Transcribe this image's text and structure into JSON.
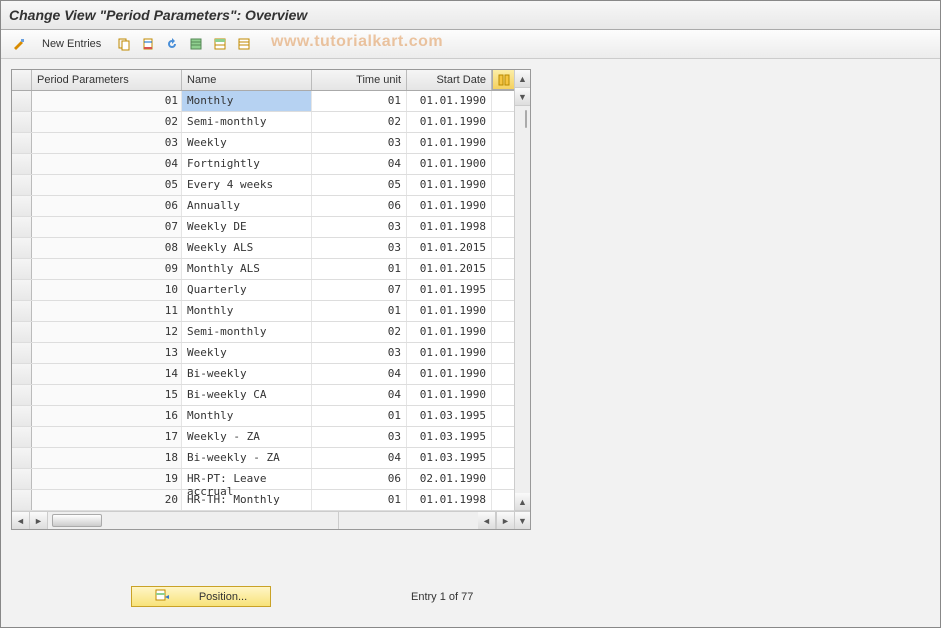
{
  "title": "Change View \"Period Parameters\": Overview",
  "toolbar": {
    "new_entries": "New Entries"
  },
  "watermark": "www.tutorialkart.com",
  "grid": {
    "headers": {
      "period_parameters": "Period Parameters",
      "name": "Name",
      "time_unit": "Time unit",
      "start_date": "Start Date"
    },
    "rows": [
      {
        "pp": "01",
        "name": "Monthly",
        "tu": "01",
        "sd": "01.01.1990"
      },
      {
        "pp": "02",
        "name": "Semi-monthly",
        "tu": "02",
        "sd": "01.01.1990"
      },
      {
        "pp": "03",
        "name": "Weekly",
        "tu": "03",
        "sd": "01.01.1990"
      },
      {
        "pp": "04",
        "name": "Fortnightly",
        "tu": "04",
        "sd": "01.01.1900"
      },
      {
        "pp": "05",
        "name": "Every 4 weeks",
        "tu": "05",
        "sd": "01.01.1990"
      },
      {
        "pp": "06",
        "name": "Annually",
        "tu": "06",
        "sd": "01.01.1990"
      },
      {
        "pp": "07",
        "name": "Weekly  DE",
        "tu": "03",
        "sd": "01.01.1998"
      },
      {
        "pp": "08",
        "name": "Weekly ALS",
        "tu": "03",
        "sd": "01.01.2015"
      },
      {
        "pp": "09",
        "name": "Monthly ALS",
        "tu": "01",
        "sd": "01.01.2015"
      },
      {
        "pp": "10",
        "name": "Quarterly",
        "tu": "07",
        "sd": "01.01.1995"
      },
      {
        "pp": "11",
        "name": "Monthly",
        "tu": "01",
        "sd": "01.01.1990"
      },
      {
        "pp": "12",
        "name": "Semi-monthly",
        "tu": "02",
        "sd": "01.01.1990"
      },
      {
        "pp": "13",
        "name": "Weekly",
        "tu": "03",
        "sd": "01.01.1990"
      },
      {
        "pp": "14",
        "name": "Bi-weekly",
        "tu": "04",
        "sd": "01.01.1990"
      },
      {
        "pp": "15",
        "name": "Bi-weekly CA",
        "tu": "04",
        "sd": "01.01.1990"
      },
      {
        "pp": "16",
        "name": "Monthly",
        "tu": "01",
        "sd": "01.03.1995"
      },
      {
        "pp": "17",
        "name": "Weekly - ZA",
        "tu": "03",
        "sd": "01.03.1995"
      },
      {
        "pp": "18",
        "name": "Bi-weekly - ZA",
        "tu": "04",
        "sd": "01.03.1995"
      },
      {
        "pp": "19",
        "name": "HR-PT: Leave accrual",
        "tu": "06",
        "sd": "02.01.1990"
      },
      {
        "pp": "20",
        "name": "HR-TH: Monthly",
        "tu": "01",
        "sd": "01.01.1998"
      }
    ]
  },
  "footer": {
    "position_label": "Position...",
    "entry_status": "Entry 1 of 77"
  }
}
